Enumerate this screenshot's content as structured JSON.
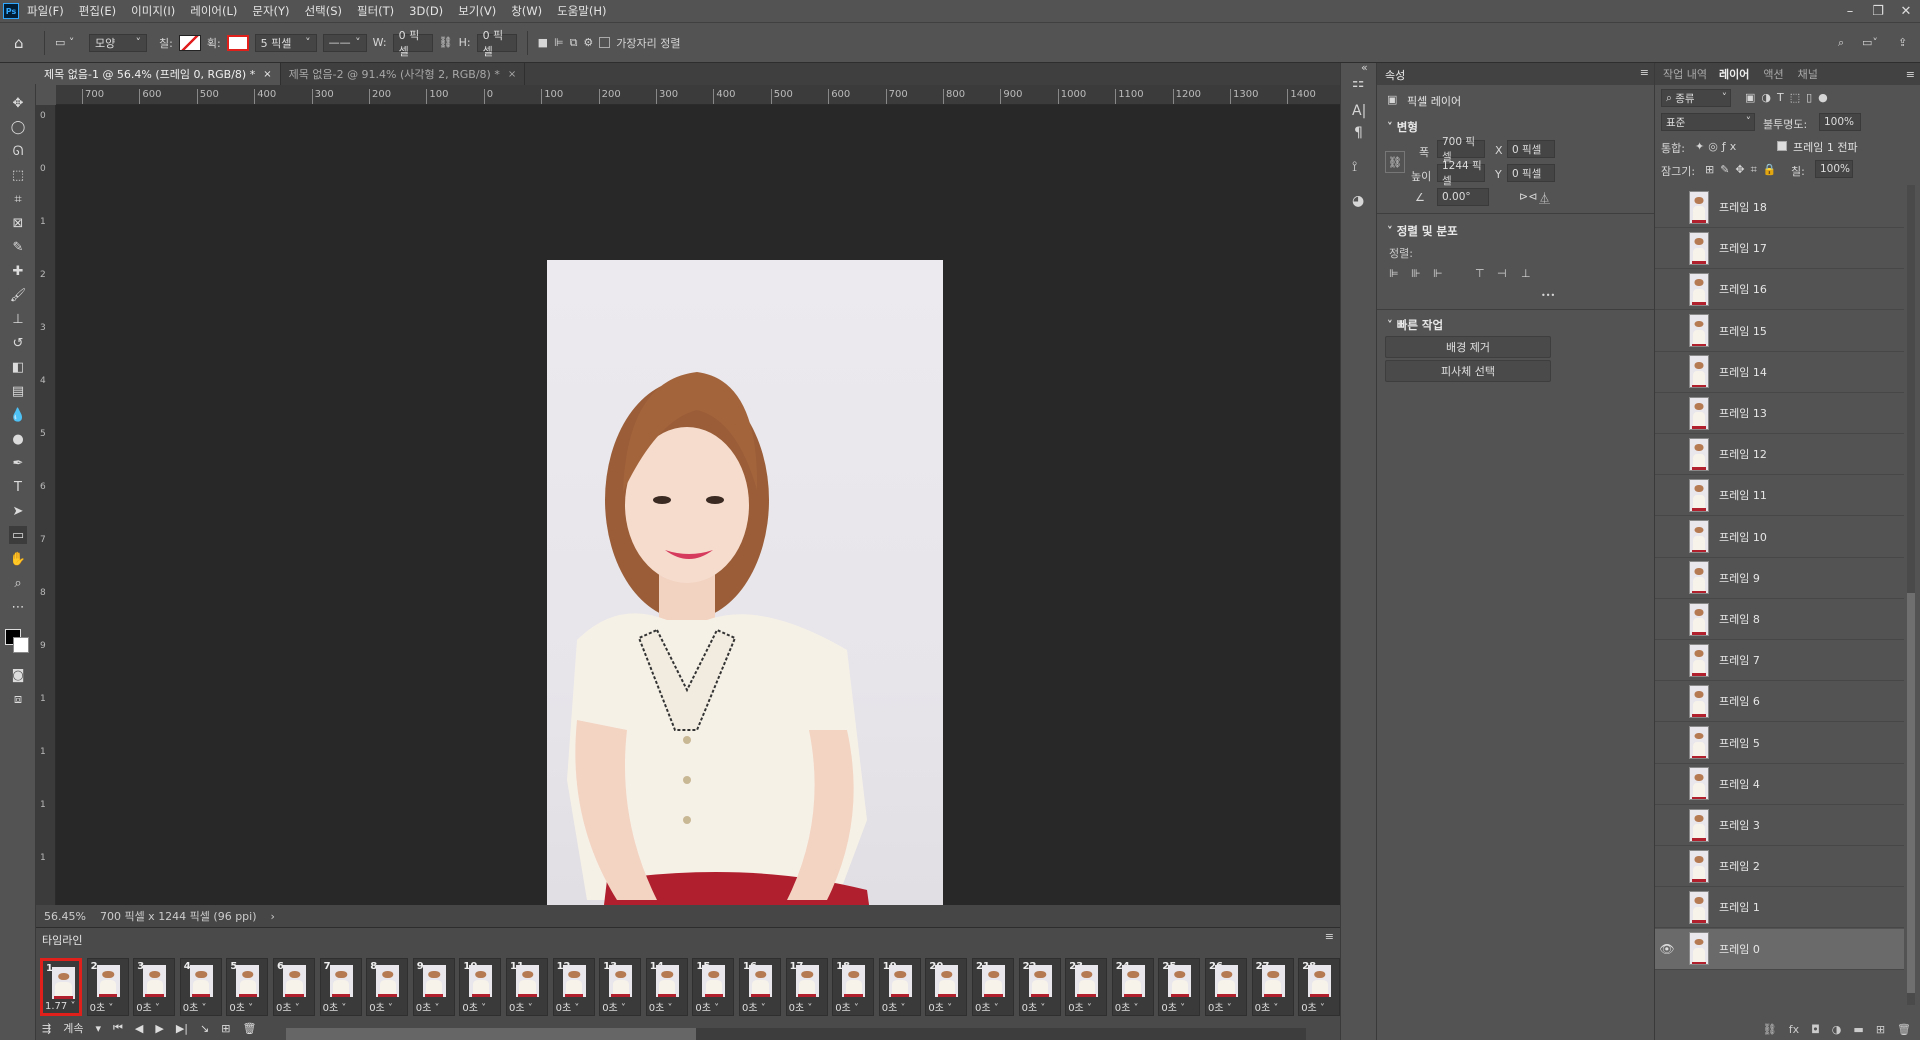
{
  "app": {
    "logo": "Ps"
  },
  "menu": [
    "파일(F)",
    "편집(E)",
    "이미지(I)",
    "레이어(L)",
    "문자(Y)",
    "선택(S)",
    "필터(T)",
    "3D(D)",
    "보기(V)",
    "창(W)",
    "도움말(H)"
  ],
  "options": {
    "shape_mode": "모양",
    "fill_label": "칠:",
    "stroke_label": "획:",
    "stroke_width": "5 픽셀",
    "w_label": "W:",
    "w_value": "0 픽셀",
    "h_label": "H:",
    "h_value": "0 픽셀",
    "align_edges": "가장자리 정렬"
  },
  "tabs": [
    {
      "label": "제목 없음-1 @ 56.4% (프레임 0, RGB/8) *",
      "close": "×"
    },
    {
      "label": "제목 없음-2 @ 91.4% (사각형 2, RGB/8) *",
      "close": "×"
    }
  ],
  "ruler_h": [
    "700",
    "600",
    "500",
    "400",
    "300",
    "200",
    "100",
    "0",
    "100",
    "200",
    "300",
    "400",
    "500",
    "600",
    "700",
    "800",
    "900",
    "1000",
    "1100",
    "1200",
    "1300",
    "1400"
  ],
  "ruler_v": [
    "0",
    "0",
    "1",
    "2",
    "3",
    "4",
    "5",
    "6",
    "7",
    "8",
    "9",
    "1",
    "1",
    "1",
    "1"
  ],
  "status": {
    "zoom": "56.45%",
    "doc": "700 픽셀 x 1244 픽셀 (96 ppi)",
    "arrow": "›"
  },
  "timeline": {
    "title": "타임라인",
    "loop": "계속",
    "frames": [
      {
        "n": "1",
        "d": "1.77"
      },
      {
        "n": "2",
        "d": "0초"
      },
      {
        "n": "3",
        "d": "0초"
      },
      {
        "n": "4",
        "d": "0초"
      },
      {
        "n": "5",
        "d": "0초"
      },
      {
        "n": "6",
        "d": "0초"
      },
      {
        "n": "7",
        "d": "0초"
      },
      {
        "n": "8",
        "d": "0초"
      },
      {
        "n": "9",
        "d": "0초"
      },
      {
        "n": "10",
        "d": "0초"
      },
      {
        "n": "11",
        "d": "0초"
      },
      {
        "n": "12",
        "d": "0초"
      },
      {
        "n": "13",
        "d": "0초"
      },
      {
        "n": "14",
        "d": "0초"
      },
      {
        "n": "15",
        "d": "0초"
      },
      {
        "n": "16",
        "d": "0초"
      },
      {
        "n": "17",
        "d": "0초"
      },
      {
        "n": "18",
        "d": "0초"
      },
      {
        "n": "19",
        "d": "0초"
      },
      {
        "n": "20",
        "d": "0초"
      },
      {
        "n": "21",
        "d": "0초"
      },
      {
        "n": "22",
        "d": "0초"
      },
      {
        "n": "23",
        "d": "0초"
      },
      {
        "n": "24",
        "d": "0초"
      },
      {
        "n": "25",
        "d": "0초"
      },
      {
        "n": "26",
        "d": "0초"
      },
      {
        "n": "27",
        "d": "0초"
      },
      {
        "n": "28",
        "d": "0초"
      }
    ]
  },
  "properties": {
    "tab": "속성",
    "kind": "픽셀 레이어",
    "transform_title": "변형",
    "w_label": "폭",
    "w_value": "700 픽셀",
    "x_label": "X",
    "x_value": "0 픽셀",
    "h_label": "높이",
    "h_value": "1244 픽셀",
    "y_label": "Y",
    "y_value": "0 픽셀",
    "angle_value": "0.00°",
    "align_title": "정렬 및 분포",
    "align_label": "정렬:",
    "more": "•••",
    "quick_title": "빠른 작업",
    "remove_bg": "배경 제거",
    "select_subject": "피사체 선택"
  },
  "layers_panel": {
    "tabs": [
      "작업 내역",
      "레이어",
      "액션",
      "채널"
    ],
    "filter": "종류",
    "blend": "표준",
    "opacity_label": "불투명도:",
    "opacity": "100%",
    "unify_label": "통합:",
    "propagate": "프레임 1 전파",
    "lock_label": "잠그기:",
    "fill_label": "칠:",
    "fill": "100%",
    "layers": [
      "프레임 18",
      "프레임 17",
      "프레임 16",
      "프레임 15",
      "프레임 14",
      "프레임 13",
      "프레임 12",
      "프레임 11",
      "프레임 10",
      "프레임 9",
      "프레임 8",
      "프레임 7",
      "프레임 6",
      "프레임 5",
      "프레임 4",
      "프레임 3",
      "프레임 2",
      "프레임 1",
      "프레임 0"
    ]
  },
  "colors": {
    "selection_outline": "#e0201b",
    "panel_bg": "#535353",
    "canvas_bg": "#282828"
  }
}
